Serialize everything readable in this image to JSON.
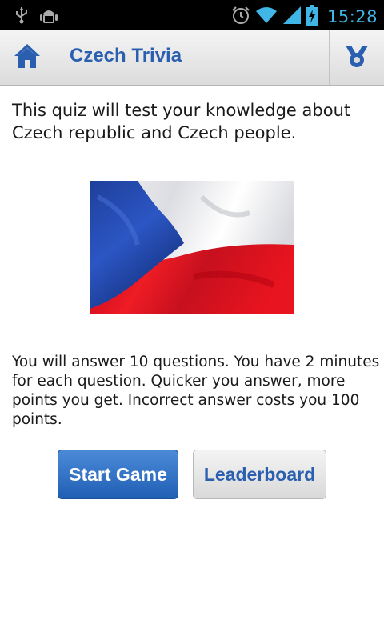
{
  "status_bar": {
    "time": "15:28",
    "icons": [
      "usb-icon",
      "android-debug-icon",
      "alarm-icon",
      "wifi-icon",
      "signal-icon",
      "battery-charging-icon"
    ],
    "time_color": "#3fb6e6"
  },
  "action_bar": {
    "home_icon": "home-icon",
    "title": "Czech Trivia",
    "leaderboard_icon": "leaderboard-icon",
    "accent": "#2a5fb0"
  },
  "main": {
    "intro_text": "This quiz will test your knowledge about Czech republic and Czech people.",
    "image": "czech-flag",
    "rules_text": "You will answer 10 questions. You have 2 minutes for each question. Quicker you answer, more points you get. Incorrect answer costs you 100 points.",
    "start_label": "Start Game",
    "leaderboard_label": "Leaderboard"
  }
}
